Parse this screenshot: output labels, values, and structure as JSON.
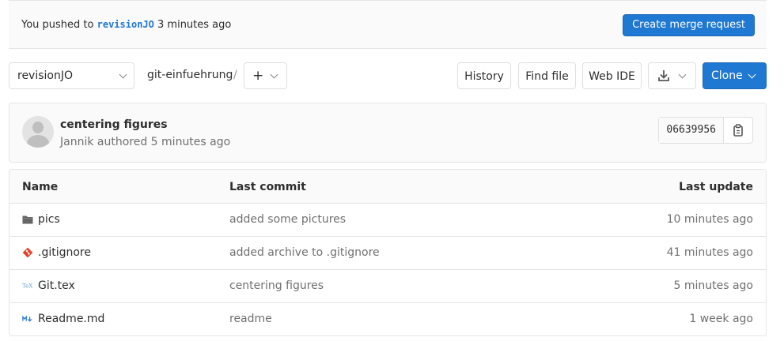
{
  "push_banner": {
    "prefix": "You pushed to",
    "branch": "revisionJO",
    "suffix": "3 minutes ago",
    "merge_request_label": "Create merge request"
  },
  "nav": {
    "branch": "revisionJO",
    "project": "git-einfuehrung",
    "separator": "/",
    "add_label": "+",
    "history_label": "History",
    "find_file_label": "Find file",
    "web_ide_label": "Web IDE",
    "clone_label": "Clone"
  },
  "commit": {
    "title": "centering figures",
    "meta": "Jannik authored 5 minutes ago",
    "sha": "06639956"
  },
  "tree": {
    "headers": {
      "name": "Name",
      "last_commit": "Last commit",
      "last_update": "Last update"
    },
    "rows": [
      {
        "icon": "folder-icon",
        "name": "pics",
        "commit": "added some pictures",
        "updated": "10 minutes ago"
      },
      {
        "icon": "git-icon",
        "name": ".gitignore",
        "commit": "added archive to .gitignore",
        "updated": "41 minutes ago"
      },
      {
        "icon": "tex-file-icon",
        "name": "Git.tex",
        "commit": "centering figures",
        "updated": "5 minutes ago"
      },
      {
        "icon": "markdown-file-icon",
        "name": "Readme.md",
        "commit": "readme",
        "updated": "1 week ago"
      }
    ]
  },
  "colors": {
    "primary": "#1f78d1",
    "git_orange": "#e24329"
  }
}
